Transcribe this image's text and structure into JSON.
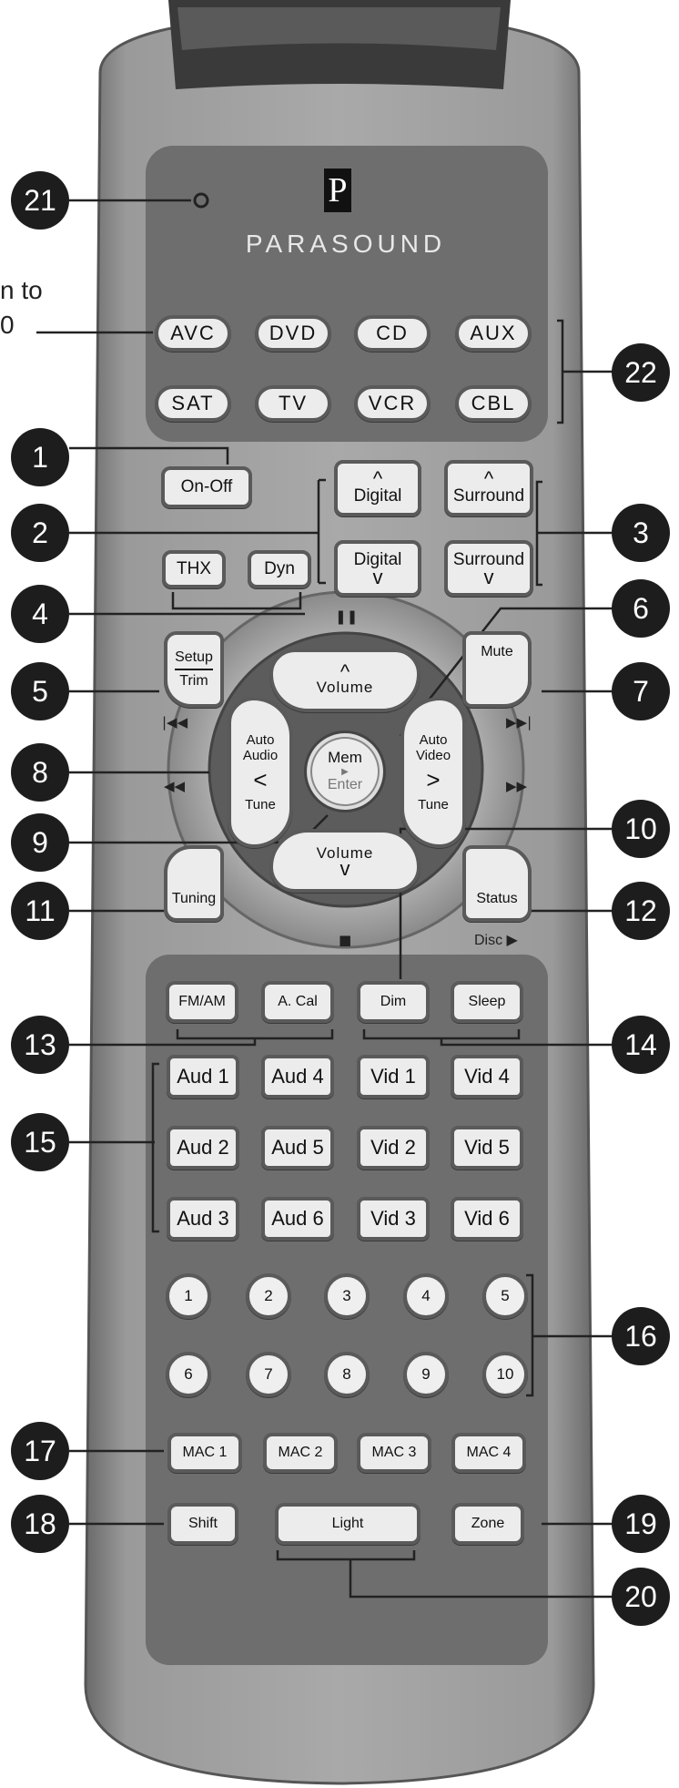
{
  "brand": {
    "name": "PARASOUND",
    "logo_glyph": "P"
  },
  "side_text": {
    "line1": "n to",
    "line2": "0"
  },
  "source_buttons": [
    "AVC",
    "DVD",
    "CD",
    "AUX",
    "SAT",
    "TV",
    "VCR",
    "CBL"
  ],
  "top_buttons": {
    "power": "On-Off",
    "digital_up": "Digital",
    "digital_down": "Digital",
    "surround_up": "Surround",
    "surround_down": "Surround",
    "thx": "THX",
    "dyn": "Dyn",
    "up_arrow": "^",
    "down_arrow": "v"
  },
  "nav": {
    "setup": "Setup",
    "trim": "Trim",
    "mute": "Mute",
    "volume_up": "Volume",
    "volume_down": "Volume",
    "auto_audio": "Auto\nAudio",
    "auto_video": "Auto\nVideo",
    "tune_left": "Tune",
    "tune_right": "Tune",
    "left_arrow": "<",
    "right_arrow": ">",
    "mem": "Mem",
    "enter": "Enter",
    "tuning": "Tuning",
    "status": "Status",
    "disc": "Disc ▶"
  },
  "transport": {
    "pause": "❚❚",
    "prev": "|◀◀",
    "next": "▶▶|",
    "rew": "◀◀",
    "ff": "▶▶",
    "stop": "■"
  },
  "mode_buttons": [
    "FM/AM",
    "A. Cal",
    "Dim",
    "Sleep"
  ],
  "input_buttons": [
    "Aud 1",
    "Aud 4",
    "Vid 1",
    "Vid 4",
    "Aud 2",
    "Aud 5",
    "Vid 2",
    "Vid 5",
    "Aud 3",
    "Aud 6",
    "Vid 3",
    "Vid 6"
  ],
  "number_buttons": [
    "1",
    "2",
    "3",
    "4",
    "5",
    "6",
    "7",
    "8",
    "9",
    "10"
  ],
  "macro_buttons": [
    "MAC 1",
    "MAC 2",
    "MAC 3",
    "MAC 4"
  ],
  "bottom_buttons": {
    "shift": "Shift",
    "light": "Light",
    "zone": "Zone"
  },
  "callouts": [
    "1",
    "2",
    "3",
    "4",
    "5",
    "6",
    "7",
    "8",
    "9",
    "10",
    "11",
    "12",
    "13",
    "14",
    "15",
    "16",
    "17",
    "18",
    "19",
    "20",
    "21",
    "22"
  ],
  "colors": {
    "body": "#8e8e8e",
    "panel": "#6e6e6e",
    "button": "#ececec",
    "button_border": "#5a5a5a",
    "callout": "#1d1d1d"
  }
}
